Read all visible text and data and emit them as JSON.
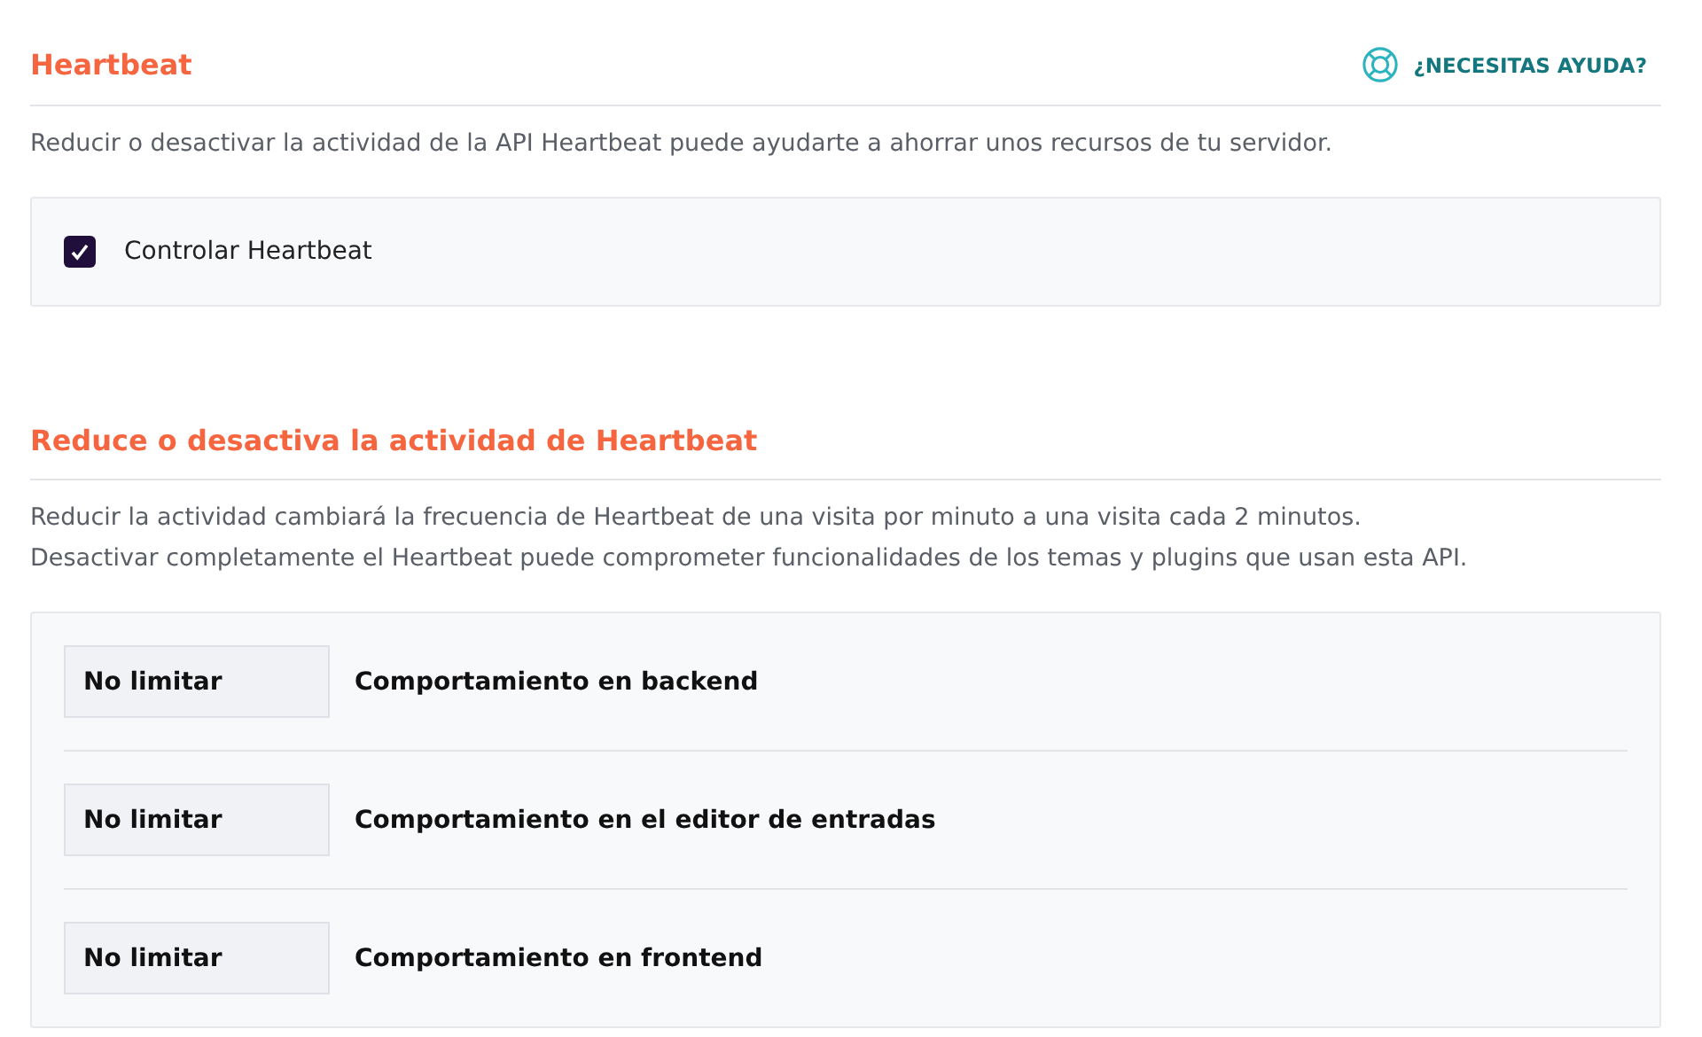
{
  "sections": [
    {
      "title": "Heartbeat",
      "help_link": "¿NECESITAS AYUDA?",
      "description": [
        "Reducir o desactivar la actividad de la API Heartbeat puede ayudarte a ahorrar unos recursos de tu servidor."
      ],
      "options": [
        {
          "kind": "checkbox",
          "label": "Controlar Heartbeat",
          "checked": true
        }
      ]
    },
    {
      "title": "Reduce o desactiva la actividad de Heartbeat",
      "description": [
        "Reducir la actividad cambiará la frecuencia de Heartbeat de una visita por minuto a una visita cada 2 minutos.",
        "Desactivar completamente el Heartbeat puede comprometer funcionalidades de los temas y plugins que usan esta API."
      ],
      "options": [
        {
          "kind": "select",
          "value": "No limitar",
          "label": "Comportamiento en backend"
        },
        {
          "kind": "select",
          "value": "No limitar",
          "label": "Comportamiento en el editor de entradas"
        },
        {
          "kind": "select",
          "value": "No limitar",
          "label": "Comportamiento en frontend"
        }
      ]
    }
  ]
}
